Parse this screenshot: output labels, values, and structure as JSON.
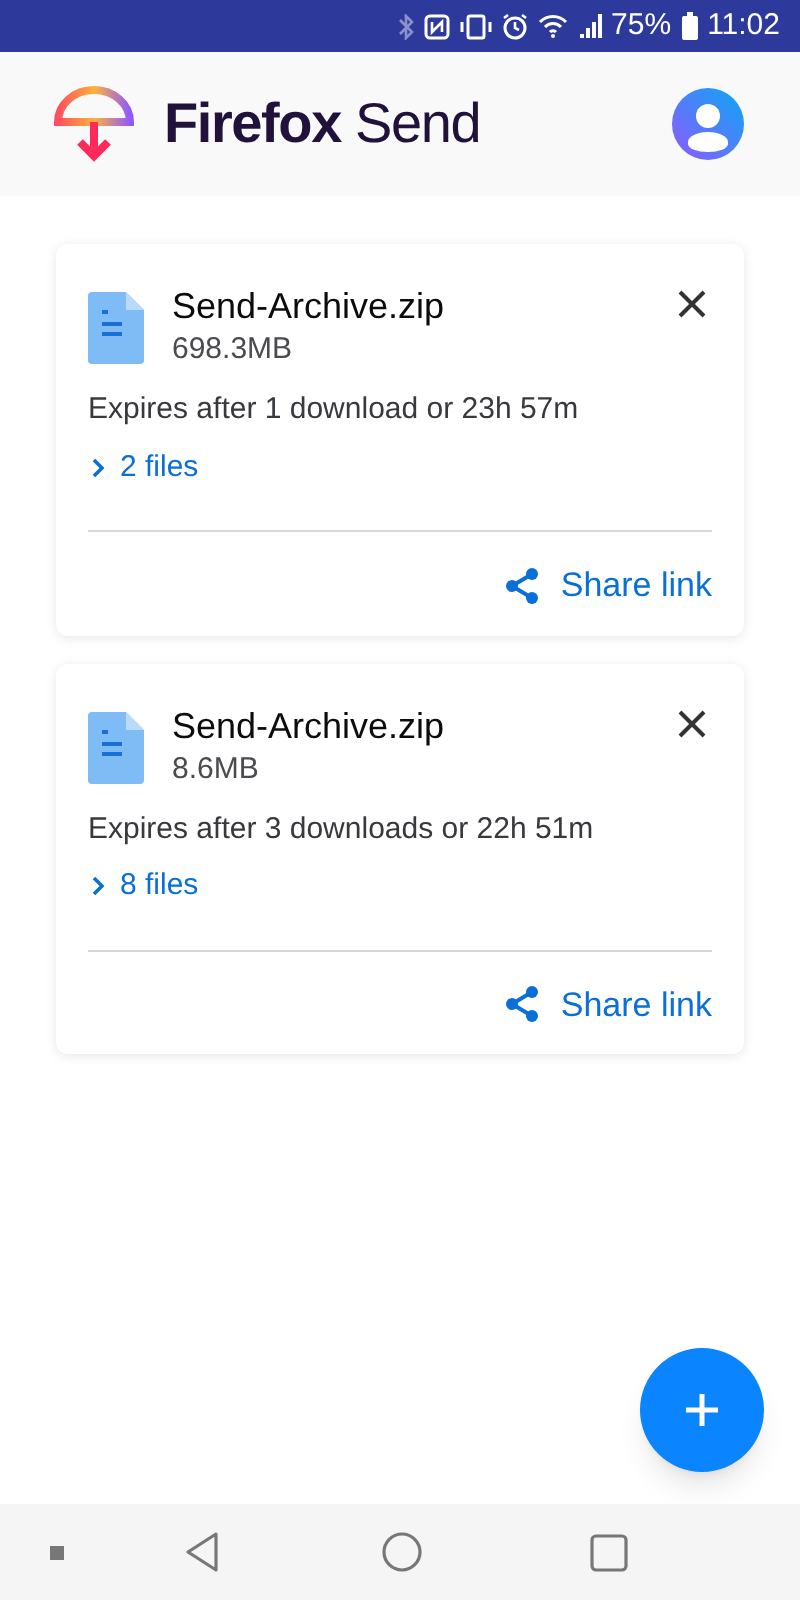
{
  "status_bar": {
    "battery": "75%",
    "time": "11:02"
  },
  "header": {
    "title": "**Firefox** Send"
  },
  "uploads": [
    {
      "name": "Send-Archive.zip",
      "size": "698.3MB",
      "expiry": "Expires after 1 download or 23h 57m",
      "files": "2 files",
      "action": "Share link"
    },
    {
      "name": "Send-Archive.zip",
      "size": "8.6MB",
      "expiry": "Expires after 3 downloads or 22h 51m",
      "files": "8 files",
      "action": "Share link"
    }
  ]
}
